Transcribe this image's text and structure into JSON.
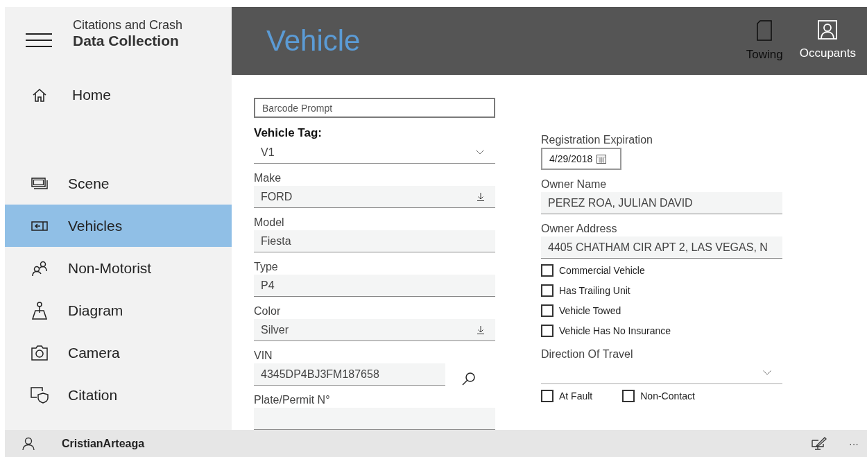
{
  "app": {
    "title_line1": "Citations and Crash",
    "title_line2": "Data Collection"
  },
  "sidebar": {
    "top_items": [
      {
        "label": "Home",
        "selected": false
      }
    ],
    "items": [
      {
        "label": "Scene",
        "selected": false
      },
      {
        "label": "Vehicles",
        "selected": true
      },
      {
        "label": "Non-Motorist",
        "selected": false
      },
      {
        "label": "Diagram",
        "selected": false
      },
      {
        "label": "Camera",
        "selected": false
      },
      {
        "label": "Citation",
        "selected": false
      }
    ]
  },
  "header": {
    "title": "Vehicle",
    "commands": [
      {
        "label": "Towing",
        "disabled": true
      },
      {
        "label": "Occupants",
        "disabled": false
      }
    ]
  },
  "form": {
    "barcode": {
      "placeholder": "Barcode Prompt"
    },
    "left_fields": [
      {
        "kind": "dropdown",
        "label": "Vehicle Tag:",
        "value": "V1"
      },
      {
        "kind": "select",
        "label": "Make",
        "value": "FORD"
      },
      {
        "kind": "text",
        "label": "Model",
        "value": "Fiesta"
      },
      {
        "kind": "text",
        "label": "Type",
        "value": "P4"
      },
      {
        "kind": "select",
        "label": "Color",
        "value": "Silver"
      },
      {
        "kind": "search",
        "label": "VIN",
        "value": "4345DP4BJ3FM187658"
      },
      {
        "kind": "text",
        "label": "Plate/Permit N°"
      }
    ],
    "registration": {
      "label": "Registration Expiration",
      "value": "4/29/2018"
    },
    "right_fields": [
      {
        "label": "Owner Name",
        "value": "PEREZ ROA, JULIAN DAVID"
      },
      {
        "label": "Owner Address",
        "value": "4405 CHATHAM CIR APT 2, LAS VEGAS, N"
      }
    ],
    "checkboxes": [
      {
        "label": "Commercial Vehicle",
        "checked": false
      },
      {
        "label": "Has Trailing Unit",
        "checked": false
      },
      {
        "label": "Vehicle Towed",
        "checked": false
      },
      {
        "label": "Vehicle Has No Insurance",
        "checked": false
      }
    ],
    "direction": {
      "label": "Direction Of Travel"
    },
    "bottom_checkboxes": [
      {
        "label": "At Fault",
        "checked": false
      },
      {
        "label": "Non-Contact",
        "checked": false
      }
    ]
  },
  "status_bar": {
    "user": "CristianArteaga",
    "more": "···"
  }
}
